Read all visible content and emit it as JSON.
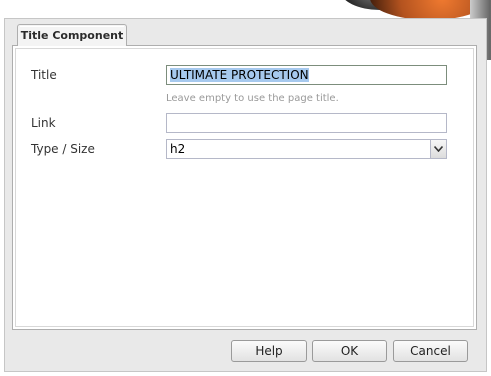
{
  "dialog": {
    "tab_label": "Title Component"
  },
  "form": {
    "title_label": "Title",
    "title_value": "ULTIMATE PROTECTION",
    "title_hint": "Leave empty to use the page title.",
    "link_label": "Link",
    "link_value": "",
    "type_label": "Type / Size",
    "type_value": "h2"
  },
  "buttons": {
    "help": "Help",
    "ok": "OK",
    "cancel": "Cancel"
  },
  "icons": {
    "combo_arrow": "chevron-down-icon"
  }
}
